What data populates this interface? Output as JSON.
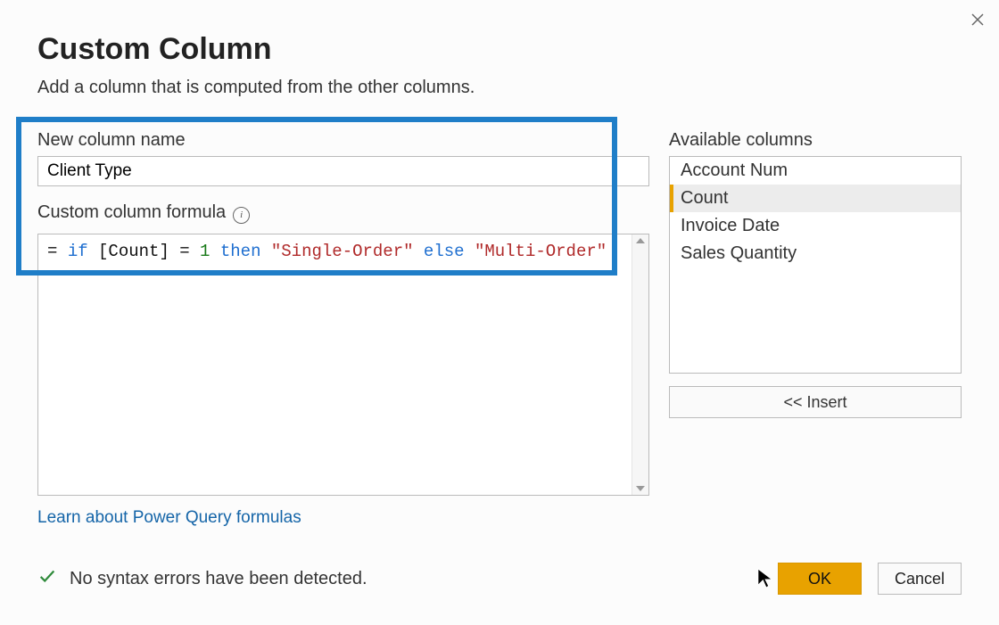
{
  "dialog": {
    "title": "Custom Column",
    "subtitle": "Add a column that is computed from the other columns."
  },
  "form": {
    "name_label": "New column name",
    "name_value": "Client Type",
    "formula_label": "Custom column formula",
    "formula_tokens": [
      {
        "t": "plain",
        "v": "= "
      },
      {
        "t": "kw",
        "v": "if"
      },
      {
        "t": "plain",
        "v": " [Count] = "
      },
      {
        "t": "num",
        "v": "1"
      },
      {
        "t": "plain",
        "v": " "
      },
      {
        "t": "kw",
        "v": "then"
      },
      {
        "t": "plain",
        "v": " "
      },
      {
        "t": "str",
        "v": "\"Single-Order\""
      },
      {
        "t": "plain",
        "v": " "
      },
      {
        "t": "kw",
        "v": "else"
      },
      {
        "t": "plain",
        "v": " "
      },
      {
        "t": "str",
        "v": "\"Multi-Order\""
      }
    ]
  },
  "available": {
    "label": "Available columns",
    "items": [
      {
        "label": "Account Num",
        "selected": false
      },
      {
        "label": "Count",
        "selected": true
      },
      {
        "label": "Invoice Date",
        "selected": false
      },
      {
        "label": "Sales Quantity",
        "selected": false
      }
    ],
    "insert_label": "<< Insert"
  },
  "link": {
    "label": "Learn about Power Query formulas"
  },
  "status": {
    "message": "No syntax errors have been detected."
  },
  "buttons": {
    "ok": "OK",
    "cancel": "Cancel"
  }
}
